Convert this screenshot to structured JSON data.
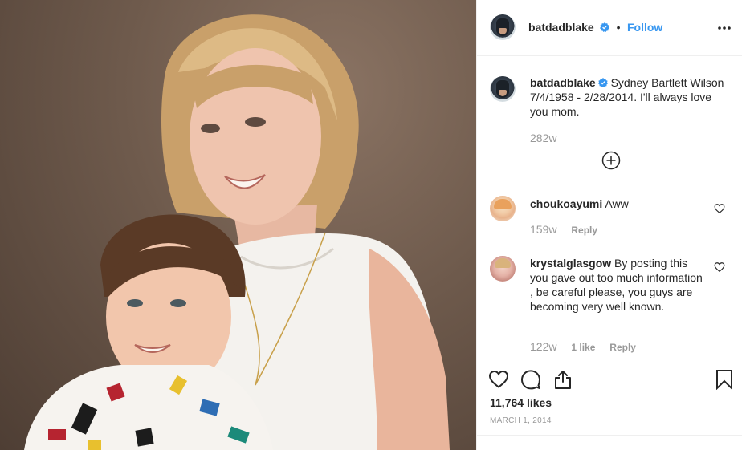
{
  "post": {
    "username": "batdadblake",
    "follow_label": "Follow",
    "dot": "•"
  },
  "caption": {
    "username": "batdadblake",
    "text": "Sydney Bartlett Wilson 7/4/1958 - 2/28/2014. I'll always love you mom.",
    "age": "282w"
  },
  "comments": [
    {
      "username": "choukoayumi",
      "text": "Aww",
      "age": "159w",
      "likes": "",
      "reply_label": "Reply"
    },
    {
      "username": "krystalglasgow",
      "text": "By posting this you gave out too much information , be careful please, you guys are becoming very well known.",
      "age": "122w",
      "likes": "1 like",
      "reply_label": "Reply"
    }
  ],
  "footer": {
    "likes": "11,764 likes",
    "date": "MARCH 1, 2014"
  },
  "colors": {
    "accent": "#3897f0",
    "text": "#262626",
    "muted": "#999999",
    "border": "#efefef"
  },
  "icons": [
    "verified-badge-icon",
    "more-options-icon",
    "load-more-comments-icon",
    "heart-icon",
    "comment-icon",
    "share-icon",
    "bookmark-icon"
  ]
}
